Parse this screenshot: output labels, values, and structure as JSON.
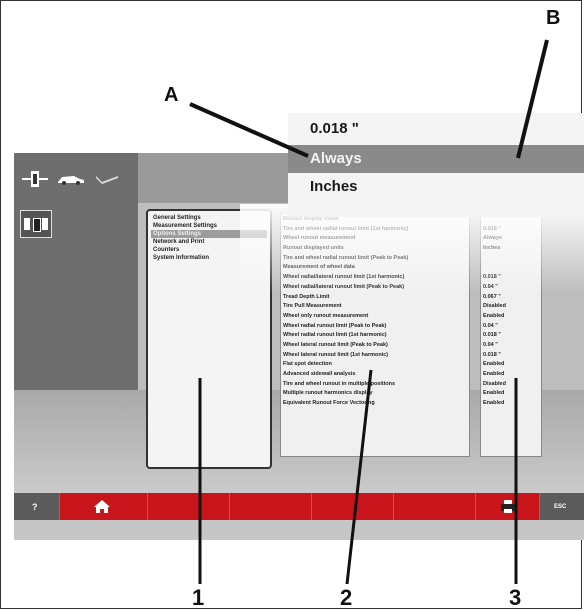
{
  "callouts": {
    "a": "A",
    "b": "B",
    "n1": "1",
    "n2": "2",
    "n3": "3"
  },
  "zoom": {
    "rows": [
      "0.018 \"",
      "Always",
      "Inches"
    ]
  },
  "menu": {
    "items": [
      "General Settings",
      "Measurement Settings",
      "Options Settings",
      "Network and Print",
      "Counters",
      "System Information"
    ],
    "selected_index": 2
  },
  "settings": [
    {
      "label": "Runout display mode",
      "value": ""
    },
    {
      "label": "Tire and wheel radial runout limit (1st harmonic)",
      "value": "0.018 \""
    },
    {
      "label": "Wheel runout measurement",
      "value": "Always"
    },
    {
      "label": "Runout displayed units",
      "value": "Inches"
    },
    {
      "label": "Tire and wheel radial runout limit (Peak to Peak)",
      "value": ""
    },
    {
      "label": "Measurement of wheel data",
      "value": ""
    },
    {
      "label": "Wheel radial/lateral runout limit (1st harmonic)",
      "value": "0.018 \""
    },
    {
      "label": "Wheel radial/lateral runout limit (Peak to Peak)",
      "value": "0.04 \""
    },
    {
      "label": "Tread Depth Limit",
      "value": "0.067 \""
    },
    {
      "label": "Tire Pull Measurement",
      "value": "Disabled"
    },
    {
      "label": "Wheel only runout measurement",
      "value": "Enabled"
    },
    {
      "label": "Wheel radial runout limit (Peak to Peak)",
      "value": "0.04 \""
    },
    {
      "label": "Wheel radial runout limit (1st harmonic)",
      "value": "0.018 \""
    },
    {
      "label": "Wheel lateral runout limit (Peak to Peak)",
      "value": "0.04 \""
    },
    {
      "label": "Wheel lateral runout limit (1st harmonic)",
      "value": "0.018 \""
    },
    {
      "label": "Flat spot detection",
      "value": "Enabled"
    },
    {
      "label": "Advanced sidewall analysis",
      "value": "Enabled"
    },
    {
      "label": "Tire and wheel runout in multiple positions",
      "value": "Disabled"
    },
    {
      "label": "Multiple runout harmonics display",
      "value": "Enabled"
    },
    {
      "label": "Equivalent Runout Force Vectoring",
      "value": "Enabled"
    }
  ],
  "toolbar": {
    "help_label": "?",
    "esc_label": "ESC"
  },
  "colors": {
    "bar": "#c8151b",
    "selected": "#9c9c9c"
  }
}
